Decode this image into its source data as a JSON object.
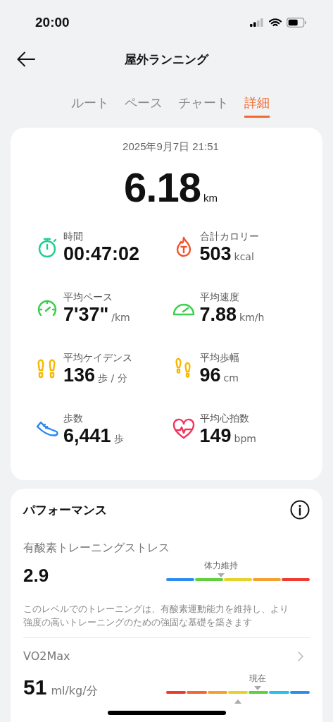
{
  "status_bar": {
    "time": "20:00"
  },
  "header": {
    "title": "屋外ランニング"
  },
  "tabs": [
    {
      "label": "ルート",
      "selected": false
    },
    {
      "label": "ペース",
      "selected": false
    },
    {
      "label": "チャート",
      "selected": false
    },
    {
      "label": "詳細",
      "selected": true
    }
  ],
  "summary": {
    "datetime": "2025年9月7日 21:51",
    "distance": "6.18",
    "distance_unit": "km",
    "metrics": [
      {
        "kind": "stopwatch",
        "color": "#1fcf8f",
        "label": "時間",
        "value": "00:47:02"
      },
      {
        "kind": "flame",
        "color": "#f4502a",
        "label": "合計カロリー",
        "value": "503",
        "unit": "kcal"
      },
      {
        "kind": "gauge",
        "color": "#3ccf4a",
        "label": "平均ペース",
        "value": "7'37\"",
        "unit": "/km"
      },
      {
        "kind": "speedometer",
        "color": "#3ccf4a",
        "label": "平均速度",
        "value": "7.88",
        "unit": "km/h"
      },
      {
        "kind": "footprints",
        "color": "#f6b800",
        "label": "平均ケイデンス",
        "value": "136",
        "unit": "歩 / 分"
      },
      {
        "kind": "steps",
        "color": "#f6b800",
        "label": "平均歩幅",
        "value": "96",
        "unit": "cm"
      },
      {
        "kind": "shoe",
        "color": "#2a86f0",
        "label": "歩数",
        "value": "6,441",
        "unit": "歩"
      },
      {
        "kind": "heart",
        "color": "#f0345a",
        "label": "平均心拍数",
        "value": "149",
        "unit": "bpm"
      }
    ]
  },
  "performance": {
    "title": "パフォーマンス",
    "stress": {
      "label": "有酸素トレーニングストレス",
      "value": "2.9",
      "marker_label": "体力維持",
      "description": "このレベルでのトレーニングは、有酸素運動能力を維持し、より強度の高いトレーニングのための強固な基礎を築きます"
    },
    "vo2max": {
      "label": "VO2Max",
      "value": "51",
      "unit": "ml/kg/分",
      "current_label": "現在"
    }
  }
}
